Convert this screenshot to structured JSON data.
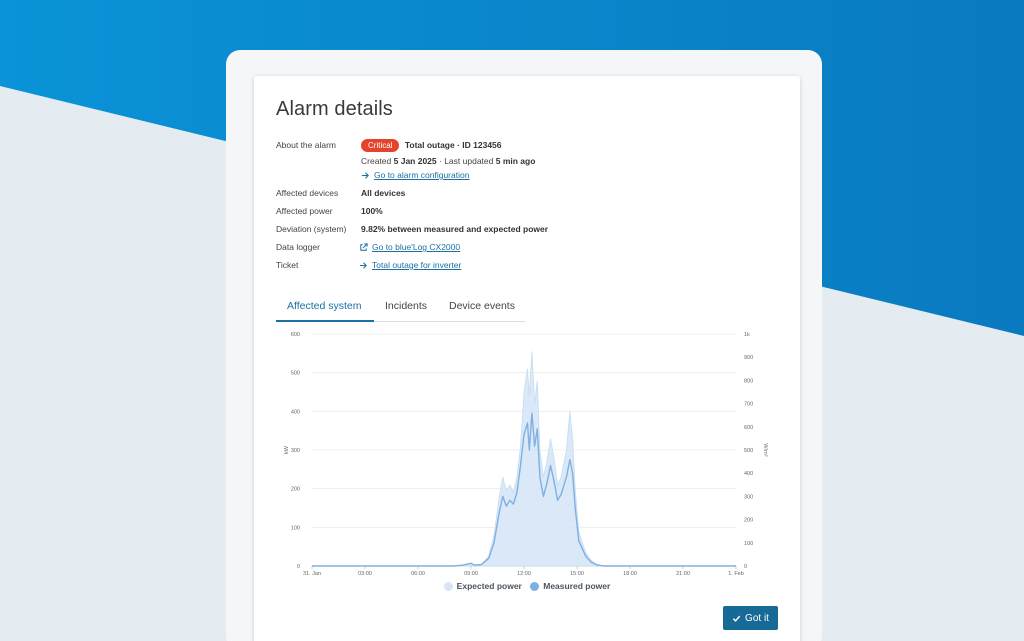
{
  "dialog": {
    "title": "Alarm details",
    "about": {
      "label": "About the alarm",
      "severity": "Critical",
      "summary": "Total outage · ID 123456",
      "created_prefix": "Created",
      "created_date": "5 Jan 2025",
      "updated_prefix": "· Last updated",
      "updated_time": "5 min ago",
      "config_link": "Go to alarm configuration"
    },
    "fields": [
      {
        "label": "Affected devices",
        "value": "All devices"
      },
      {
        "label": "Affected power",
        "value": "100%"
      },
      {
        "label": "Deviation (system)",
        "value": "9.82% between measured and expected power"
      }
    ],
    "data_logger": {
      "label": "Data logger",
      "link": "Go to blue'Log CX2000"
    },
    "ticket": {
      "label": "Ticket",
      "link": "Total outage for inverter"
    },
    "tabs": [
      {
        "label": "Affected system",
        "active": true
      },
      {
        "label": "Incidents",
        "active": false
      },
      {
        "label": "Device events",
        "active": false
      }
    ],
    "button_label": "Got it"
  },
  "colors": {
    "accent": "#1a6fa3",
    "critical": "#e5432b",
    "expected": "#d6e6f6",
    "measured": "#7fb0e3",
    "button": "#176a96"
  },
  "chart_data": {
    "type": "area",
    "x_ticks": [
      "31. Jan",
      "03:00",
      "06:00",
      "09:00",
      "12:00",
      "15:00",
      "18:00",
      "21:00",
      "1. Feb"
    ],
    "y_left": {
      "label": "kW",
      "ticks": [
        "0",
        "100",
        "200",
        "300",
        "400",
        "500",
        "600"
      ],
      "lim": [
        0,
        600
      ]
    },
    "y_right": {
      "label": "W/m²",
      "ticks": [
        "0",
        "100",
        "200",
        "300",
        "400",
        "500",
        "600",
        "700",
        "800",
        "900",
        "1k"
      ],
      "lim": [
        0,
        1000
      ]
    },
    "x_range_hours": [
      0,
      24
    ],
    "series": [
      {
        "name": "Expected power",
        "points": [
          [
            0,
            0
          ],
          [
            8,
            0
          ],
          [
            8.5,
            2
          ],
          [
            9,
            8
          ],
          [
            9.2,
            3
          ],
          [
            9.6,
            5
          ],
          [
            10.0,
            25
          ],
          [
            10.3,
            80
          ],
          [
            10.6,
            180
          ],
          [
            10.8,
            230
          ],
          [
            11.0,
            195
          ],
          [
            11.2,
            210
          ],
          [
            11.4,
            190
          ],
          [
            11.6,
            230
          ],
          [
            11.8,
            310
          ],
          [
            12.0,
            450
          ],
          [
            12.2,
            510
          ],
          [
            12.3,
            440
          ],
          [
            12.45,
            555
          ],
          [
            12.6,
            420
          ],
          [
            12.75,
            480
          ],
          [
            12.9,
            300
          ],
          [
            13.1,
            230
          ],
          [
            13.3,
            270
          ],
          [
            13.5,
            330
          ],
          [
            13.7,
            280
          ],
          [
            13.9,
            210
          ],
          [
            14.1,
            230
          ],
          [
            14.4,
            300
          ],
          [
            14.6,
            400
          ],
          [
            14.75,
            330
          ],
          [
            14.9,
            200
          ],
          [
            15.1,
            90
          ],
          [
            15.3,
            60
          ],
          [
            15.5,
            35
          ],
          [
            15.8,
            15
          ],
          [
            16.1,
            5
          ],
          [
            16.5,
            0
          ],
          [
            24,
            0
          ]
        ]
      },
      {
        "name": "Measured power",
        "points": [
          [
            0,
            0
          ],
          [
            8,
            0
          ],
          [
            8.5,
            2
          ],
          [
            9,
            7
          ],
          [
            9.2,
            2
          ],
          [
            9.6,
            4
          ],
          [
            10.0,
            20
          ],
          [
            10.3,
            60
          ],
          [
            10.6,
            140
          ],
          [
            10.8,
            180
          ],
          [
            11.0,
            155
          ],
          [
            11.2,
            170
          ],
          [
            11.4,
            160
          ],
          [
            11.6,
            190
          ],
          [
            11.8,
            260
          ],
          [
            12.0,
            340
          ],
          [
            12.2,
            370
          ],
          [
            12.3,
            300
          ],
          [
            12.45,
            395
          ],
          [
            12.6,
            310
          ],
          [
            12.75,
            355
          ],
          [
            12.9,
            230
          ],
          [
            13.1,
            180
          ],
          [
            13.3,
            215
          ],
          [
            13.5,
            260
          ],
          [
            13.7,
            220
          ],
          [
            13.9,
            170
          ],
          [
            14.1,
            185
          ],
          [
            14.4,
            230
          ],
          [
            14.6,
            275
          ],
          [
            14.75,
            240
          ],
          [
            14.9,
            150
          ],
          [
            15.1,
            65
          ],
          [
            15.3,
            45
          ],
          [
            15.5,
            25
          ],
          [
            15.8,
            10
          ],
          [
            16.1,
            3
          ],
          [
            16.5,
            0
          ],
          [
            24,
            0
          ]
        ]
      }
    ],
    "legend": [
      "Expected power",
      "Measured power"
    ],
    "legend_position": "bottom",
    "grid": true
  }
}
